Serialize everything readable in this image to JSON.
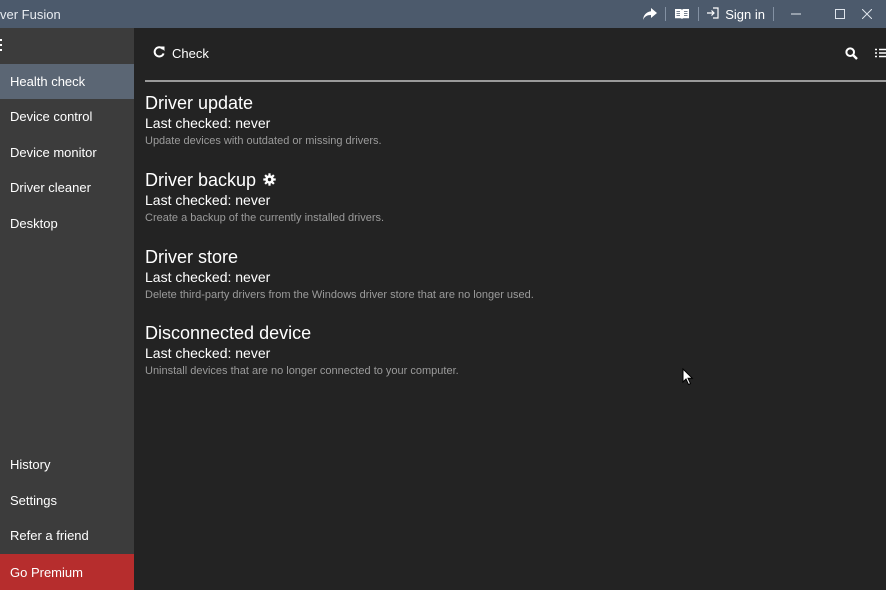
{
  "app": {
    "title": "ver Fusion"
  },
  "titlebar": {
    "sign_in_label": "Sign in"
  },
  "sidebar": {
    "top_items": [
      {
        "label": "Health check",
        "active": true
      },
      {
        "label": "Device control"
      },
      {
        "label": "Device monitor"
      },
      {
        "label": "Driver cleaner"
      },
      {
        "label": "Desktop"
      }
    ],
    "bottom_items": [
      {
        "label": "History"
      },
      {
        "label": "Settings"
      },
      {
        "label": "Refer a friend"
      }
    ],
    "premium_label": "Go Premium"
  },
  "toolbar": {
    "check_label": "Check"
  },
  "checks": [
    {
      "title": "Driver update",
      "checked": "Last checked: never",
      "desc": "Update devices with outdated or missing drivers."
    },
    {
      "title": "Driver backup",
      "checked": "Last checked: never",
      "desc": "Create a backup of the currently installed drivers.",
      "icon": "gear-icon"
    },
    {
      "title": "Driver store",
      "checked": "Last checked: never",
      "desc": "Delete third-party drivers from the Windows driver store that are no longer used."
    },
    {
      "title": "Disconnected device",
      "checked": "Last checked: never",
      "desc": "Uninstall devices that are no longer connected to your computer."
    }
  ],
  "colors": {
    "titlebar": "#4c5a6c",
    "sidebar": "#3c3c3c",
    "sidebar_active": "#5b6674",
    "premium": "#b62d2d",
    "content_bg": "#232323"
  }
}
